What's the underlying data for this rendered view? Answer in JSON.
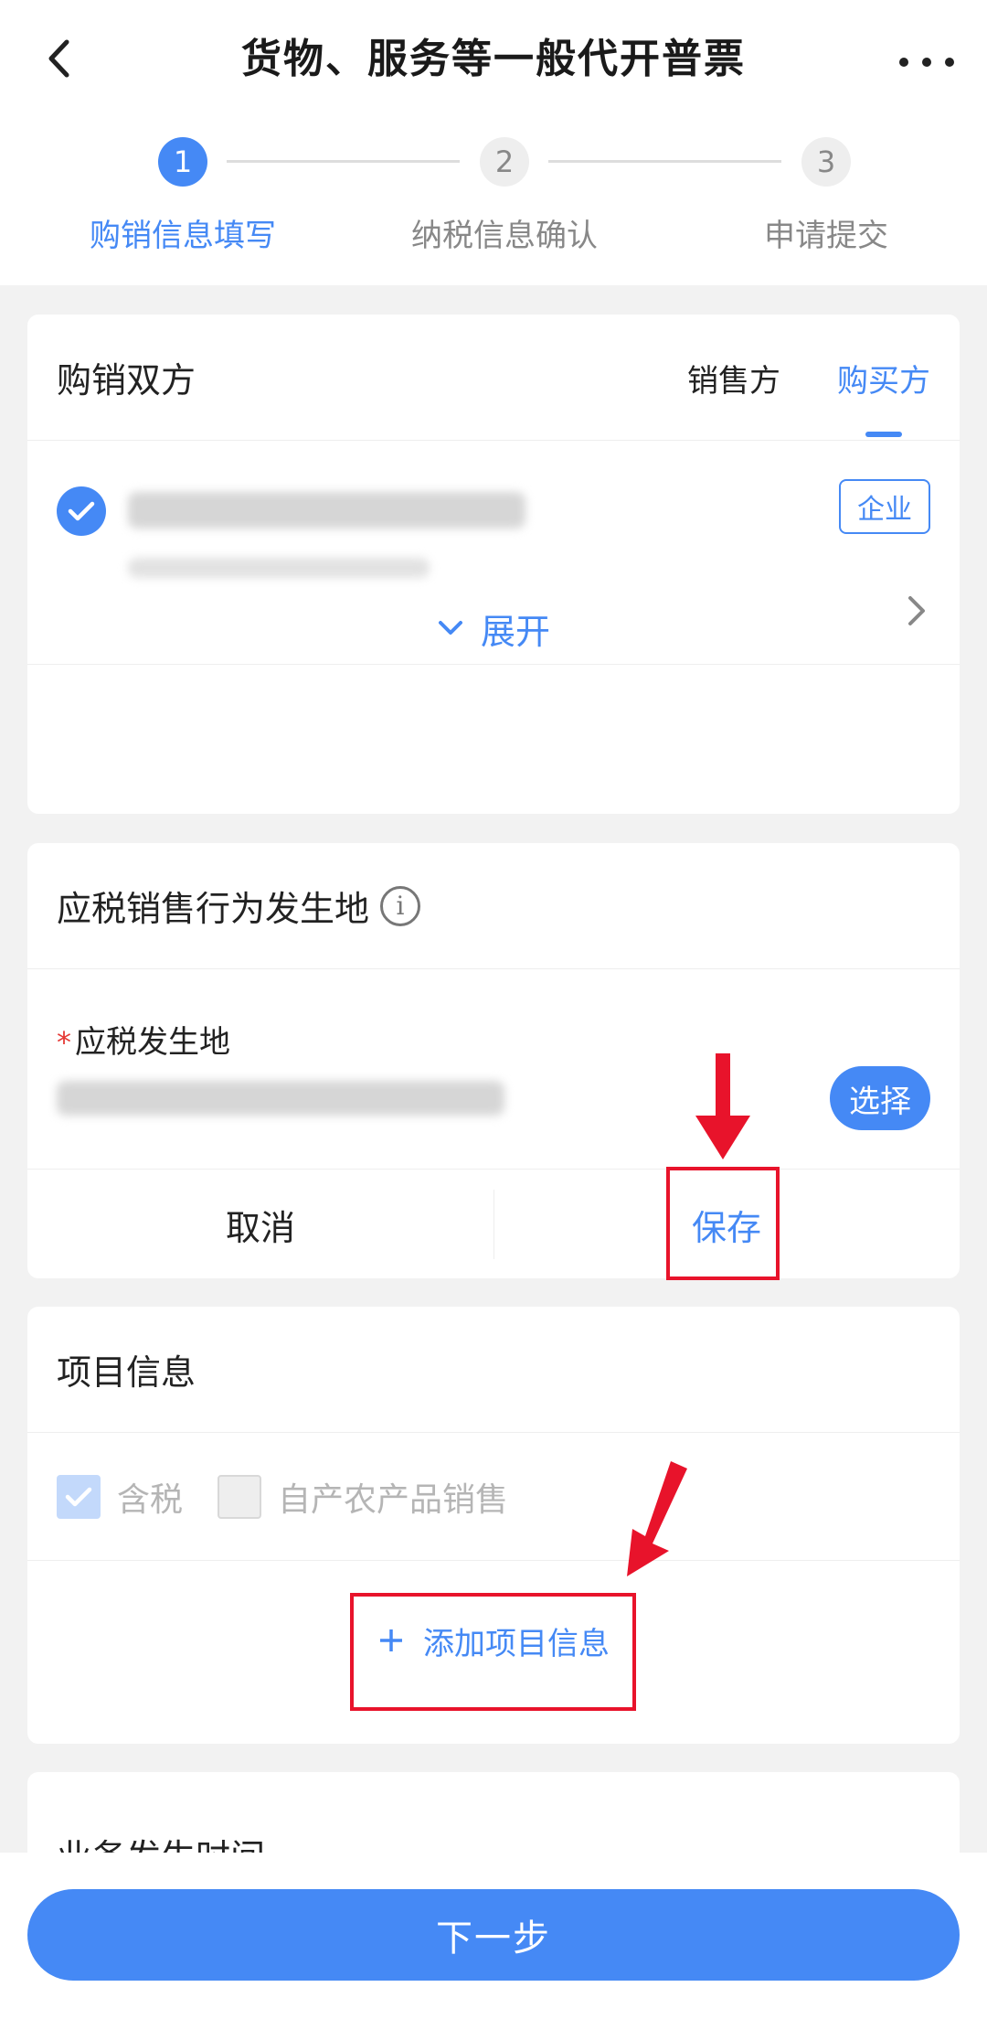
{
  "header": {
    "title": "货物、服务等一般代开普票"
  },
  "steps": [
    {
      "number": "1",
      "label": "购销信息填写",
      "active": true
    },
    {
      "number": "2",
      "label": "纳税信息确认",
      "active": false
    },
    {
      "number": "3",
      "label": "申请提交",
      "active": false
    }
  ],
  "parties": {
    "title": "购销双方",
    "tabs": [
      "销售方",
      "购买方"
    ],
    "selected_tab": "购买方",
    "entity_badge": "企业",
    "expand_label": "展开"
  },
  "location": {
    "title": "应税销售行为发生地",
    "field_label": "应税发生地",
    "required_mark": "*",
    "select_label": "选择",
    "cancel_label": "取消",
    "save_label": "保存"
  },
  "items": {
    "title": "项目信息",
    "tax_included_label": "含税",
    "tax_included_checked": true,
    "agri_label": "自产农产品销售",
    "agri_checked": false,
    "add_label": "添加项目信息"
  },
  "business_time": {
    "title": "业务发生时间"
  },
  "footer": {
    "next_label": "下一步"
  },
  "colors": {
    "primary": "#4589f5",
    "annotation_red": "#e8132b"
  }
}
